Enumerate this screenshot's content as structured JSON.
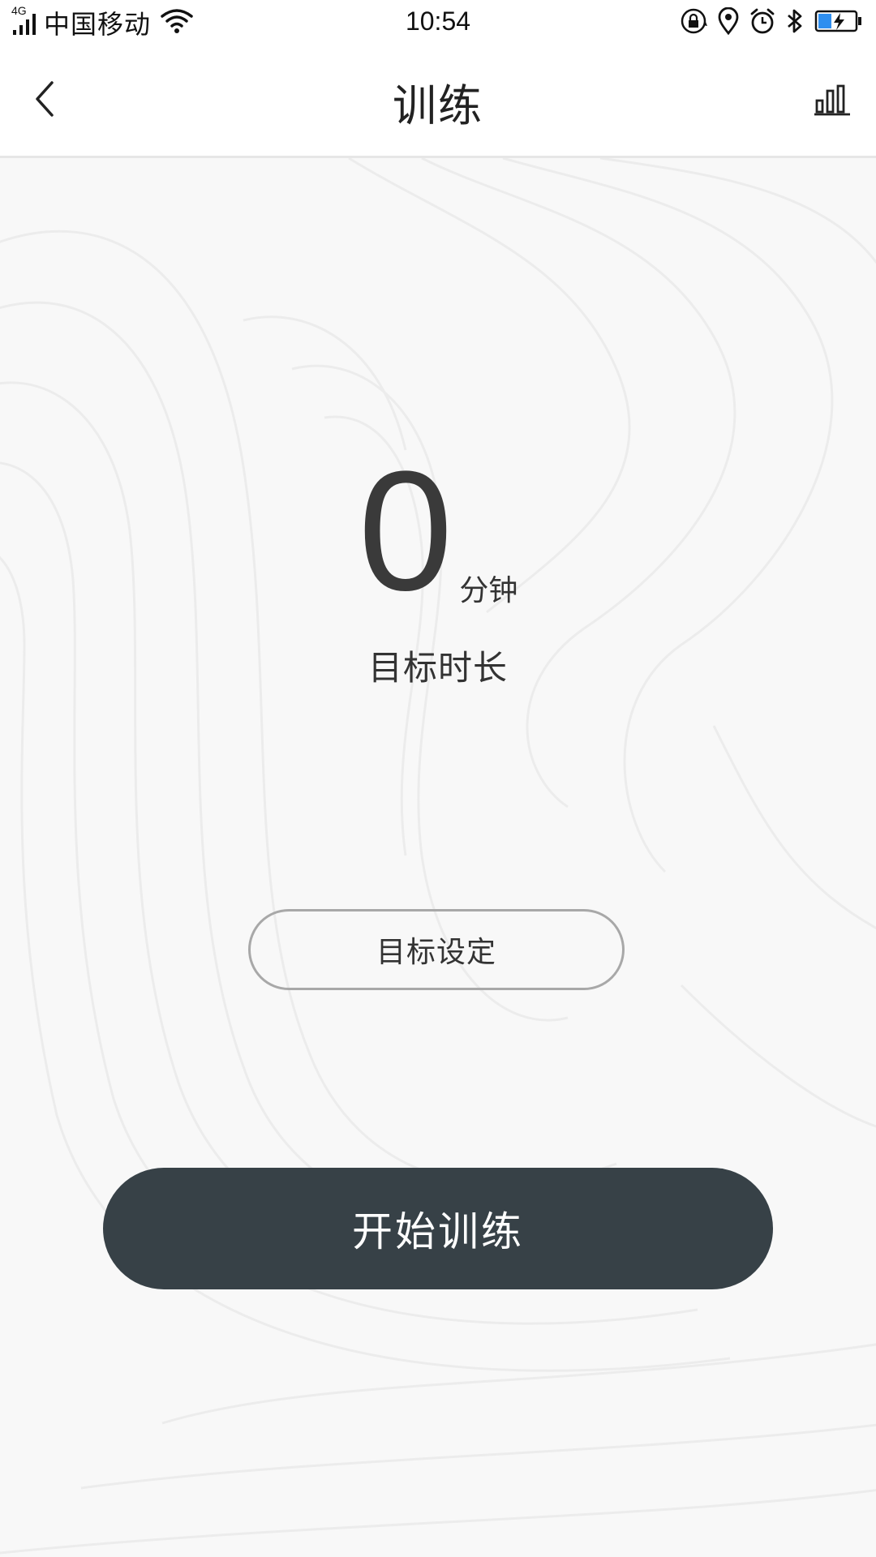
{
  "status_bar": {
    "network_type": "4G",
    "carrier": "中国移动",
    "time": "10:54",
    "icons": [
      "signal-icon",
      "wifi-icon",
      "rotation-lock-icon",
      "location-icon",
      "alarm-icon",
      "bluetooth-icon",
      "battery-charging-icon"
    ]
  },
  "header": {
    "title": "训练",
    "back_icon": "chevron-left-icon",
    "stats_icon": "bar-chart-icon"
  },
  "goal": {
    "value": "0",
    "unit": "分钟",
    "label": "目标时长"
  },
  "actions": {
    "set_target_label": "目标设定",
    "start_label": "开始训练"
  },
  "colors": {
    "primary_button": "#374147",
    "background": "#f8f8f8",
    "outline": "#a8a8a8"
  }
}
